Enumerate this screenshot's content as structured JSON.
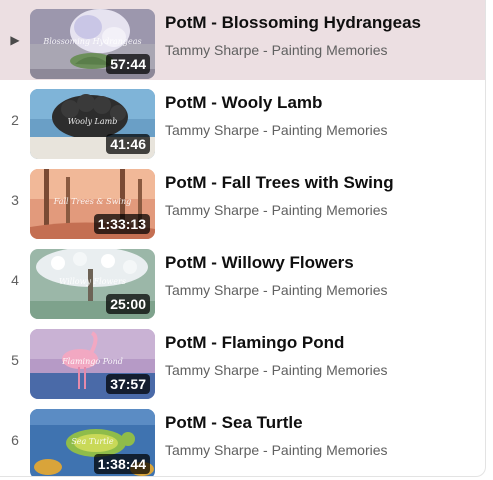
{
  "playlist": {
    "items": [
      {
        "index": "▶",
        "title": "PotM - Blossoming Hydrangeas",
        "channel": "Tammy Sharpe - Painting Memories",
        "duration": "57:44",
        "caption": "Blossoming Hydrangeas",
        "active": true
      },
      {
        "index": "2",
        "title": "PotM - Wooly Lamb",
        "channel": "Tammy Sharpe - Painting Memories",
        "duration": "41:46",
        "caption": "Wooly Lamb",
        "active": false
      },
      {
        "index": "3",
        "title": "PotM - Fall Trees with Swing",
        "channel": "Tammy Sharpe - Painting Memories",
        "duration": "1:33:13",
        "caption": "Fall Trees & Swing",
        "active": false
      },
      {
        "index": "4",
        "title": "PotM - Willowy Flowers",
        "channel": "Tammy Sharpe - Painting Memories",
        "duration": "25:00",
        "caption": "Willowy Flowers",
        "active": false
      },
      {
        "index": "5",
        "title": "PotM - Flamingo Pond",
        "channel": "Tammy Sharpe - Painting Memories",
        "duration": "37:57",
        "caption": "Flamingo Pond",
        "active": false
      },
      {
        "index": "6",
        "title": "PotM - Sea Turtle",
        "channel": "Tammy Sharpe - Painting Memories",
        "duration": "1:38:44",
        "caption": "Sea Turtle",
        "active": false
      }
    ]
  }
}
